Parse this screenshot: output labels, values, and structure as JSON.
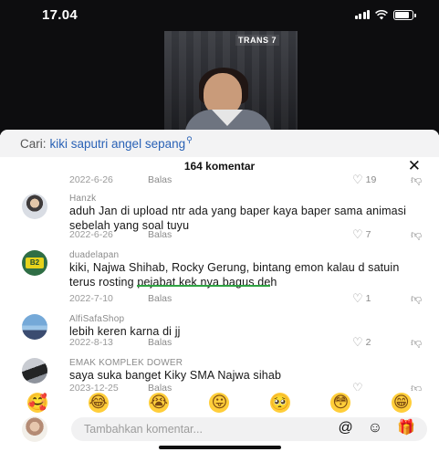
{
  "status_bar": {
    "time": "17.04",
    "battery_level": 0.82,
    "icons": [
      "signal-icon",
      "wifi-icon",
      "battery-icon"
    ]
  },
  "video": {
    "channel_logo": "TRANS 7"
  },
  "search": {
    "prefix": "Cari:",
    "query": "kiki saputri angel sepang",
    "query_icon": "search-icon"
  },
  "comments_header": {
    "count_label": "164 komentar",
    "close_icon": "close-icon"
  },
  "comments": [
    {
      "author": "",
      "text": "",
      "date": "2022-6-26",
      "reply_label": "Balas",
      "likes": "19"
    },
    {
      "author": "Hanzk",
      "text": "aduh Jan di upload ntr ada yang baper kaya baper sama animasi sebelah yang soal tuyu",
      "date": "2022-6-26",
      "reply_label": "Balas",
      "likes": "7"
    },
    {
      "author": "duadelapan",
      "text": "kiki, Najwa Shihab, Rocky Gerung, bintang emon kalau d satuin terus rosting pejabat kek nya bagus deh",
      "date": "2022-7-10",
      "reply_label": "Balas",
      "likes": "1"
    },
    {
      "author": "AlfiSafaShop",
      "text": "lebih keren karna di jj",
      "date": "2022-8-13",
      "reply_label": "Balas",
      "likes": "2"
    },
    {
      "author": "EMAK KOMPLEK DOWER",
      "text": "saya suka banget Kiky SMA Najwa sihab",
      "date": "2023-12-25",
      "reply_label": "Balas",
      "likes": ""
    }
  ],
  "emoji_bar": [
    "🥰",
    "😂",
    "😭",
    "😛",
    "🥺",
    "😳",
    "😁"
  ],
  "input_bar": {
    "placeholder": "Tambahkan komentar...",
    "actions": [
      "@",
      "☺",
      "🎁"
    ]
  },
  "colors": {
    "accent_link": "#2a62b6",
    "highlight_underline": "#2fa443"
  }
}
